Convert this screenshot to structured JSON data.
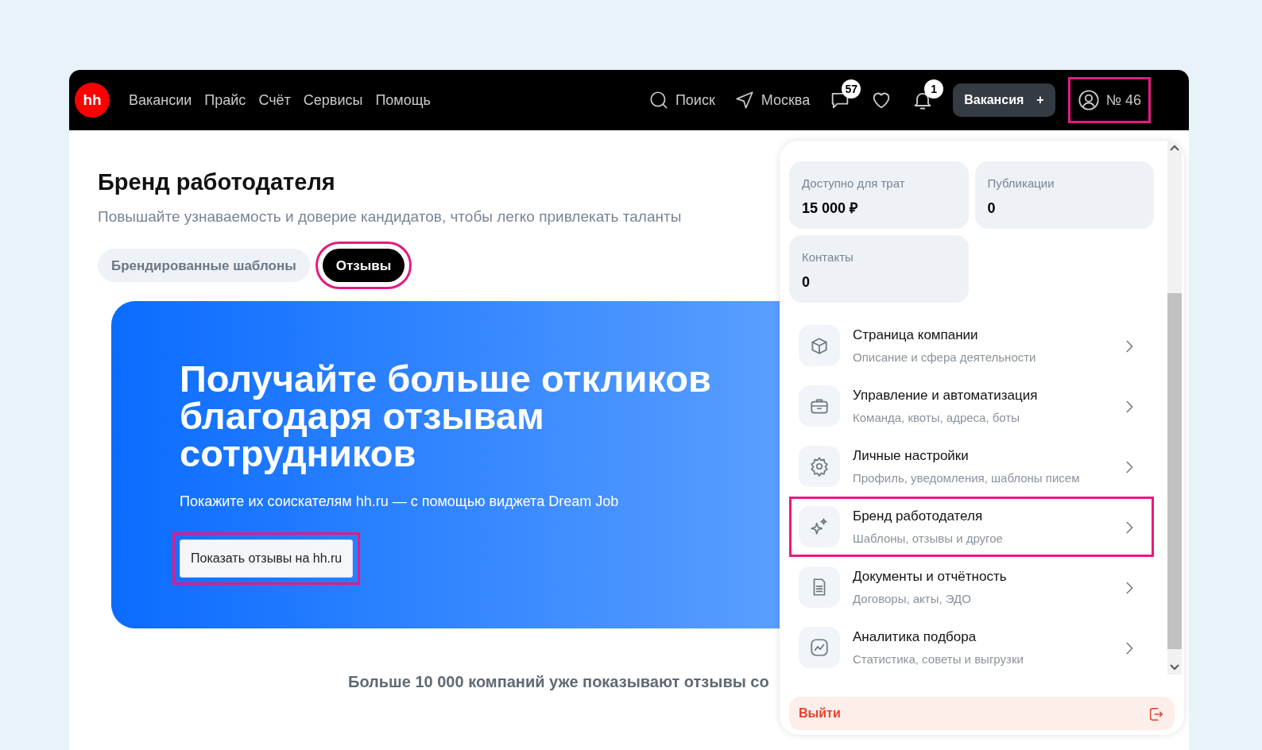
{
  "header": {
    "logo": "hh",
    "nav": [
      {
        "label": "Вакансии"
      },
      {
        "label": "Прайс"
      },
      {
        "label": "Счёт"
      },
      {
        "label": "Сервисы"
      },
      {
        "label": "Помощь"
      }
    ],
    "search": "Поиск",
    "city": "Москва",
    "icons": [
      {
        "kind": "chat",
        "badge": "57"
      },
      {
        "kind": "heart"
      },
      {
        "kind": "bell",
        "badge": "1"
      }
    ],
    "vacancy_button": {
      "label": "Вакансия",
      "icon": "+"
    },
    "account": {
      "label": "№ 46",
      "highlighted": true
    }
  },
  "page": {
    "title": "Бренд работодателя",
    "subtitle": "Повышайте узнаваемость и доверие кандидатов, чтобы легко привлекать таланты",
    "tabs": [
      {
        "label": "Брендированные шаблоны",
        "selected": false,
        "highlighted": false
      },
      {
        "label": "Отзывы",
        "selected": true,
        "highlighted": true
      }
    ],
    "banner": {
      "headline": "Получайте больше откликов благодаря отзывам сотрудников",
      "text": "Покажите их соискателям hh.ru — с помощью виджета Dream Job",
      "button": {
        "label": "Показать отзывы на hh.ru",
        "highlighted": true
      }
    },
    "footer_text": "Больше 10 000 компаний уже показывают отзывы со"
  },
  "dropdown": {
    "stats": [
      {
        "label": "Доступно для трат",
        "value": "15 000 ₽"
      },
      {
        "label": "Публикации",
        "value": "0"
      },
      {
        "label": "Контакты",
        "value": "0"
      }
    ],
    "menu": [
      {
        "kind": "box",
        "title": "Страница компании",
        "subtitle": "Описание и сфера деятельности",
        "highlighted": false
      },
      {
        "kind": "case",
        "title": "Управление и автоматизация",
        "subtitle": "Команда, квоты, адреса, боты",
        "highlighted": false
      },
      {
        "kind": "gear",
        "title": "Личные настройки",
        "subtitle": "Профиль, уведомления, шаблоны писем",
        "highlighted": false
      },
      {
        "kind": "sparkle",
        "title": "Бренд работодателя",
        "subtitle": "Шаблоны, отзывы и другое",
        "highlighted": true
      },
      {
        "kind": "doc",
        "title": "Документы и отчётность",
        "subtitle": "Договоры, акты, ЭДО",
        "highlighted": false
      },
      {
        "kind": "chart",
        "title": "Аналитика подбора",
        "subtitle": "Статистика, советы и выгрузки",
        "highlighted": false
      }
    ],
    "logout": "Выйти"
  }
}
